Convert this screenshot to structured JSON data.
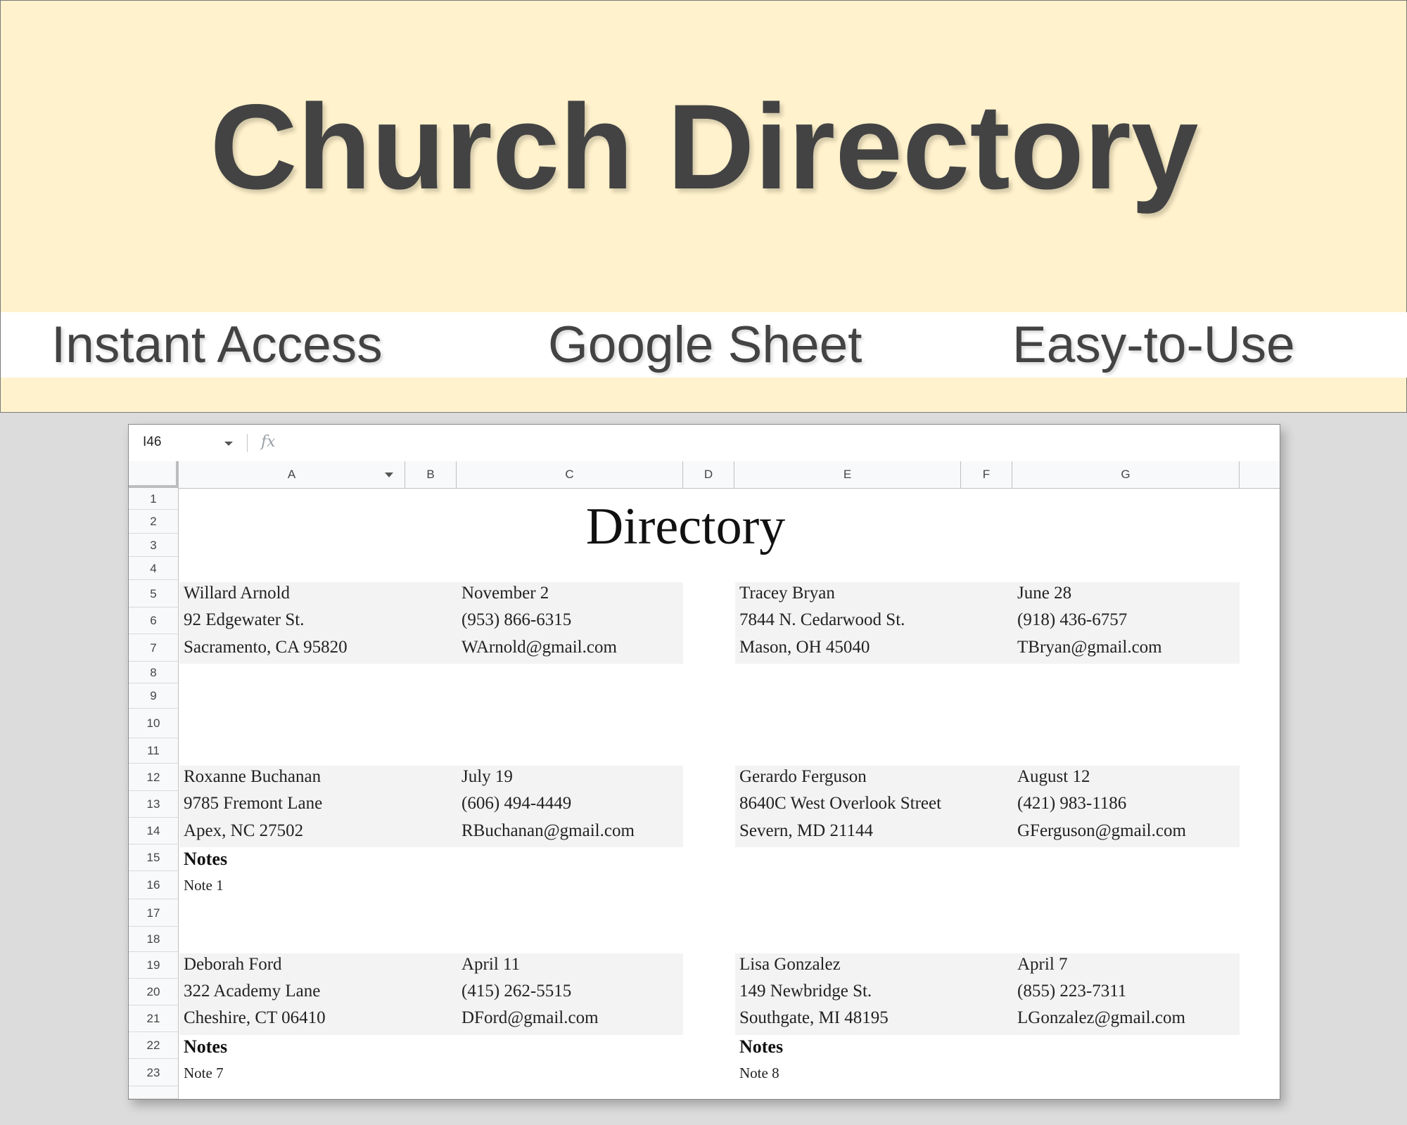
{
  "banner": {
    "title": "Church Directory",
    "features": [
      "Instant Access",
      "Google Sheet",
      "Easy-to-Use"
    ]
  },
  "sheet": {
    "name_box": "I46",
    "fx_label": "fx",
    "columns": [
      "A",
      "B",
      "C",
      "D",
      "E",
      "F",
      "G"
    ],
    "rows": [
      "1",
      "2",
      "3",
      "4",
      "5",
      "6",
      "7",
      "8",
      "9",
      "10",
      "11",
      "12",
      "13",
      "14",
      "15",
      "16",
      "17",
      "18",
      "19",
      "20",
      "21",
      "22",
      "23"
    ],
    "title": "Directory",
    "entries": [
      {
        "name": "Willard Arnold",
        "address": "92 Edgewater St.",
        "city": "Sacramento, CA 95820",
        "birthday": "November 2",
        "phone": "(953) 866-6315",
        "email": "WArnold@gmail.com"
      },
      {
        "name": "Tracey Bryan",
        "address": "7844 N. Cedarwood St.",
        "city": "Mason, OH 45040",
        "birthday": "June 28",
        "phone": "(918) 436-6757",
        "email": "TBryan@gmail.com"
      },
      {
        "name": "Roxanne Buchanan",
        "address": "9785 Fremont Lane",
        "city": "Apex, NC 27502",
        "birthday": "July 19",
        "phone": "(606) 494-4449",
        "email": "RBuchanan@gmail.com",
        "notes_label": "Notes",
        "note": "Note 1"
      },
      {
        "name": "Gerardo Ferguson",
        "address": "8640C West Overlook Street",
        "city": "Severn, MD 21144",
        "birthday": "August 12",
        "phone": "(421) 983-1186",
        "email": "GFerguson@gmail.com"
      },
      {
        "name": "Deborah Ford",
        "address": "322 Academy Lane",
        "city": "Cheshire, CT 06410",
        "birthday": "April 11",
        "phone": "(415) 262-5515",
        "email": "DFord@gmail.com",
        "notes_label": "Notes",
        "note": "Note 7"
      },
      {
        "name": "Lisa Gonzalez",
        "address": "149 Newbridge St.",
        "city": "Southgate, MI 48195",
        "birthday": "April 7",
        "phone": "(855) 223-7311",
        "email": "LGonzalez@gmail.com",
        "notes_label": "Notes",
        "note": "Note 8"
      }
    ]
  }
}
